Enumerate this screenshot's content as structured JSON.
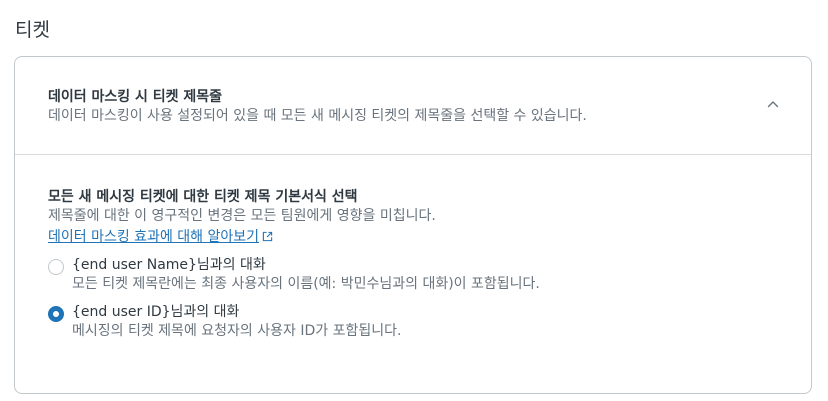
{
  "page": {
    "title": "티켓"
  },
  "masking_section": {
    "title": "데이터 마스킹 시 티켓 제목줄",
    "description": "데이터 마스킹이 사용 설정되어 있을 때 모든 새 메시징 티켓의 제목줄을 선택할 수 있습니다.",
    "collapse_icon": "chevron-up-icon"
  },
  "format_section": {
    "title": "모든 새 메시징 티켓에 대한 티켓 제목 기본서식 선택",
    "description": "제목줄에 대한 이 영구적인 변경은 모든 팀원에게 영향을 미칩니다.",
    "learn_more_link": "데이터 마스킹 효과에 대해 알아보기",
    "link_icon": "external-link-icon",
    "options": [
      {
        "label": "{end user Name}님과의 대화",
        "hint": "모든 티켓 제목란에는 최종 사용자의 이름(예: 박민수님과의 대화)이 포함됩니다.",
        "selected": false
      },
      {
        "label": "{end user ID}님과의 대화",
        "hint": "메시징의 티켓 제목에 요청자의 사용자 ID가 포함됩니다.",
        "selected": true
      }
    ]
  },
  "colors": {
    "accent": "#1f73b7",
    "text_primary": "#2f3941",
    "text_secondary": "#68737d",
    "border": "#c2c8cc"
  }
}
